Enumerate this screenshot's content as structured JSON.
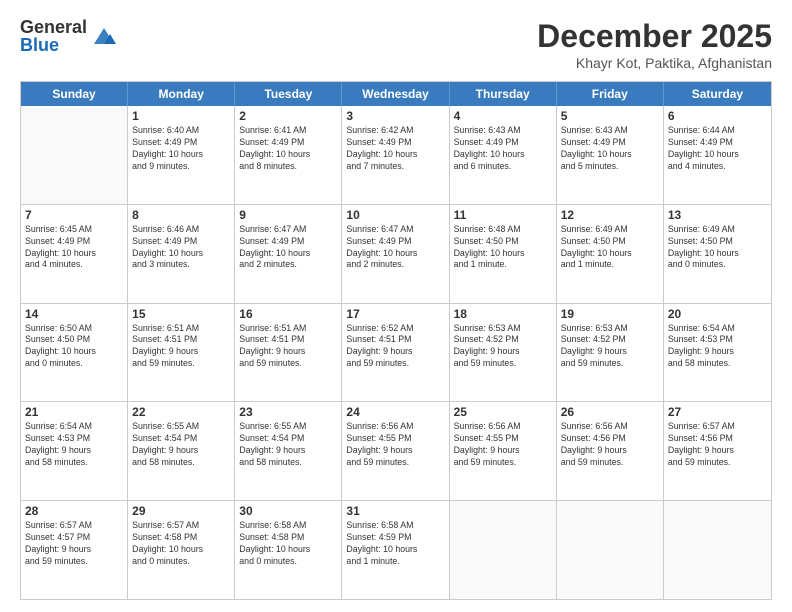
{
  "header": {
    "logo_general": "General",
    "logo_blue": "Blue",
    "month_title": "December 2025",
    "location": "Khayr Kot, Paktika, Afghanistan"
  },
  "weekdays": [
    "Sunday",
    "Monday",
    "Tuesday",
    "Wednesday",
    "Thursday",
    "Friday",
    "Saturday"
  ],
  "rows": [
    [
      {
        "day": "",
        "info": ""
      },
      {
        "day": "1",
        "info": "Sunrise: 6:40 AM\nSunset: 4:49 PM\nDaylight: 10 hours\nand 9 minutes."
      },
      {
        "day": "2",
        "info": "Sunrise: 6:41 AM\nSunset: 4:49 PM\nDaylight: 10 hours\nand 8 minutes."
      },
      {
        "day": "3",
        "info": "Sunrise: 6:42 AM\nSunset: 4:49 PM\nDaylight: 10 hours\nand 7 minutes."
      },
      {
        "day": "4",
        "info": "Sunrise: 6:43 AM\nSunset: 4:49 PM\nDaylight: 10 hours\nand 6 minutes."
      },
      {
        "day": "5",
        "info": "Sunrise: 6:43 AM\nSunset: 4:49 PM\nDaylight: 10 hours\nand 5 minutes."
      },
      {
        "day": "6",
        "info": "Sunrise: 6:44 AM\nSunset: 4:49 PM\nDaylight: 10 hours\nand 4 minutes."
      }
    ],
    [
      {
        "day": "7",
        "info": "Sunrise: 6:45 AM\nSunset: 4:49 PM\nDaylight: 10 hours\nand 4 minutes."
      },
      {
        "day": "8",
        "info": "Sunrise: 6:46 AM\nSunset: 4:49 PM\nDaylight: 10 hours\nand 3 minutes."
      },
      {
        "day": "9",
        "info": "Sunrise: 6:47 AM\nSunset: 4:49 PM\nDaylight: 10 hours\nand 2 minutes."
      },
      {
        "day": "10",
        "info": "Sunrise: 6:47 AM\nSunset: 4:49 PM\nDaylight: 10 hours\nand 2 minutes."
      },
      {
        "day": "11",
        "info": "Sunrise: 6:48 AM\nSunset: 4:50 PM\nDaylight: 10 hours\nand 1 minute."
      },
      {
        "day": "12",
        "info": "Sunrise: 6:49 AM\nSunset: 4:50 PM\nDaylight: 10 hours\nand 1 minute."
      },
      {
        "day": "13",
        "info": "Sunrise: 6:49 AM\nSunset: 4:50 PM\nDaylight: 10 hours\nand 0 minutes."
      }
    ],
    [
      {
        "day": "14",
        "info": "Sunrise: 6:50 AM\nSunset: 4:50 PM\nDaylight: 10 hours\nand 0 minutes."
      },
      {
        "day": "15",
        "info": "Sunrise: 6:51 AM\nSunset: 4:51 PM\nDaylight: 9 hours\nand 59 minutes."
      },
      {
        "day": "16",
        "info": "Sunrise: 6:51 AM\nSunset: 4:51 PM\nDaylight: 9 hours\nand 59 minutes."
      },
      {
        "day": "17",
        "info": "Sunrise: 6:52 AM\nSunset: 4:51 PM\nDaylight: 9 hours\nand 59 minutes."
      },
      {
        "day": "18",
        "info": "Sunrise: 6:53 AM\nSunset: 4:52 PM\nDaylight: 9 hours\nand 59 minutes."
      },
      {
        "day": "19",
        "info": "Sunrise: 6:53 AM\nSunset: 4:52 PM\nDaylight: 9 hours\nand 59 minutes."
      },
      {
        "day": "20",
        "info": "Sunrise: 6:54 AM\nSunset: 4:53 PM\nDaylight: 9 hours\nand 58 minutes."
      }
    ],
    [
      {
        "day": "21",
        "info": "Sunrise: 6:54 AM\nSunset: 4:53 PM\nDaylight: 9 hours\nand 58 minutes."
      },
      {
        "day": "22",
        "info": "Sunrise: 6:55 AM\nSunset: 4:54 PM\nDaylight: 9 hours\nand 58 minutes."
      },
      {
        "day": "23",
        "info": "Sunrise: 6:55 AM\nSunset: 4:54 PM\nDaylight: 9 hours\nand 58 minutes."
      },
      {
        "day": "24",
        "info": "Sunrise: 6:56 AM\nSunset: 4:55 PM\nDaylight: 9 hours\nand 59 minutes."
      },
      {
        "day": "25",
        "info": "Sunrise: 6:56 AM\nSunset: 4:55 PM\nDaylight: 9 hours\nand 59 minutes."
      },
      {
        "day": "26",
        "info": "Sunrise: 6:56 AM\nSunset: 4:56 PM\nDaylight: 9 hours\nand 59 minutes."
      },
      {
        "day": "27",
        "info": "Sunrise: 6:57 AM\nSunset: 4:56 PM\nDaylight: 9 hours\nand 59 minutes."
      }
    ],
    [
      {
        "day": "28",
        "info": "Sunrise: 6:57 AM\nSunset: 4:57 PM\nDaylight: 9 hours\nand 59 minutes."
      },
      {
        "day": "29",
        "info": "Sunrise: 6:57 AM\nSunset: 4:58 PM\nDaylight: 10 hours\nand 0 minutes."
      },
      {
        "day": "30",
        "info": "Sunrise: 6:58 AM\nSunset: 4:58 PM\nDaylight: 10 hours\nand 0 minutes."
      },
      {
        "day": "31",
        "info": "Sunrise: 6:58 AM\nSunset: 4:59 PM\nDaylight: 10 hours\nand 1 minute."
      },
      {
        "day": "",
        "info": ""
      },
      {
        "day": "",
        "info": ""
      },
      {
        "day": "",
        "info": ""
      }
    ]
  ]
}
